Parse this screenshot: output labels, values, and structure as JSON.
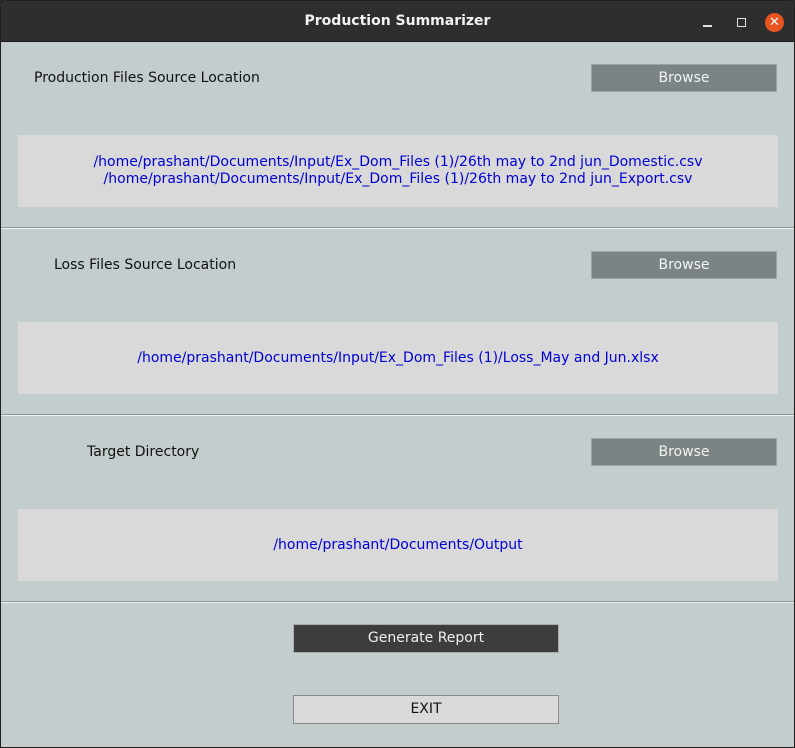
{
  "window": {
    "title": "Production Summarizer",
    "close_glyph": "✕"
  },
  "sections": [
    {
      "label": "Production Files Source Location",
      "browse_label": "Browse",
      "paths": [
        "/home/prashant/Documents/Input/Ex_Dom_Files (1)/26th may to 2nd jun_Domestic.csv",
        "/home/prashant/Documents/Input/Ex_Dom_Files (1)/26th may to 2nd jun_Export.csv"
      ]
    },
    {
      "label": "Loss Files Source Location",
      "browse_label": "Browse",
      "paths": [
        "/home/prashant/Documents/Input/Ex_Dom_Files (1)/Loss_May and Jun.xlsx"
      ]
    },
    {
      "label": "Target Directory",
      "browse_label": "Browse",
      "paths": [
        "/home/prashant/Documents/Output"
      ]
    }
  ],
  "actions": {
    "generate_label": "Generate Report",
    "exit_label": "EXIT"
  },
  "colors": {
    "window_bg": "#c3cdcd",
    "path_text": "#0000d4",
    "browse_bg": "#7b8484",
    "generate_bg": "#3d3d3d",
    "close_bg": "#e9541f"
  }
}
